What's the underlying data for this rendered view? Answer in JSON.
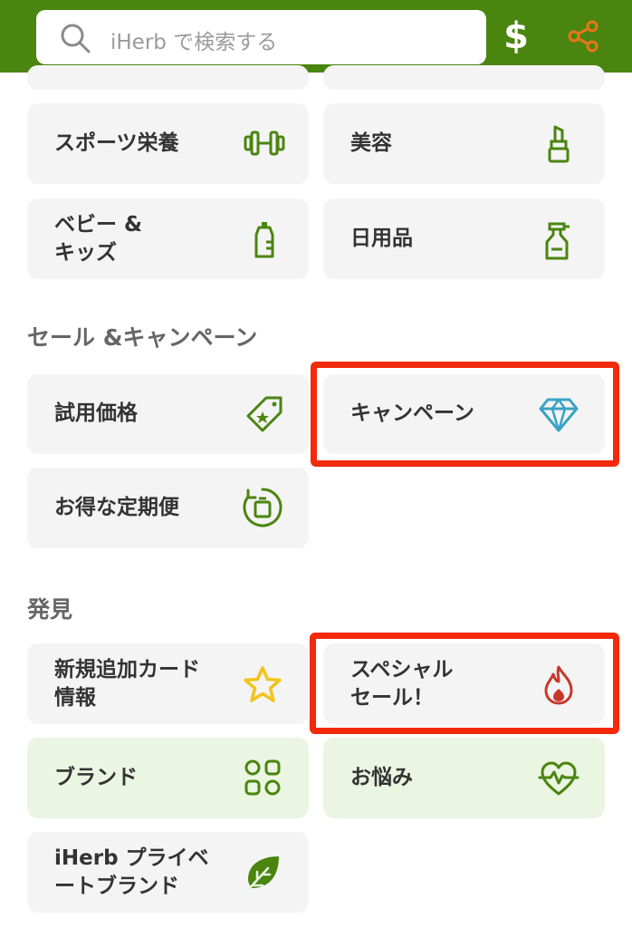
{
  "search": {
    "placeholder": "iHerb で検索する"
  },
  "header": {
    "currency_symbol": "$"
  },
  "categories": {
    "sports": "スポーツ栄養",
    "beauty": "美容",
    "baby_kids": "ベビー &\nキッズ",
    "household": "日用品"
  },
  "sale_section": {
    "title": "セール &キャンペーン",
    "trial_price": "試用価格",
    "campaign": "キャンペーン",
    "subscription": "お得な定期便"
  },
  "discover_section": {
    "title": "発見",
    "new_arrivals": "新規追加カード\n情報",
    "special_sale": "スペシャル\nセール！",
    "brands": "ブランド",
    "concerns": "お悩み",
    "private_brand": "iHerb プライベ\nートブランド"
  },
  "colors": {
    "brand_green": "#4a850f",
    "icon_green": "#4a850f",
    "share_orange": "#e8761a",
    "diamond_blue": "#3aa3c4",
    "star_yellow": "#f2c31a",
    "fire_red": "#c8382a",
    "highlight_red": "#f22a0b"
  }
}
